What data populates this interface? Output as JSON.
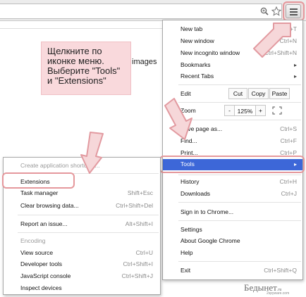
{
  "callout": {
    "line1": "Щелкните по",
    "line2": "иконке меню.",
    "line3": "Выберите \"Tools\"",
    "line4": "и \"Extensions\""
  },
  "page_text": "images",
  "menu": {
    "new_tab": {
      "label": "New tab",
      "shortcut": "Ctrl+T"
    },
    "new_window": {
      "label": "New window",
      "shortcut": "Ctrl+N"
    },
    "new_incognito": {
      "label": "New incognito window",
      "shortcut": "Ctrl+Shift+N"
    },
    "bookmarks": {
      "label": "Bookmarks"
    },
    "recent_tabs": {
      "label": "Recent Tabs"
    },
    "edit": {
      "label": "Edit",
      "cut": "Cut",
      "copy": "Copy",
      "paste": "Paste"
    },
    "zoom": {
      "label": "Zoom",
      "minus": "-",
      "value": "125%",
      "plus": "+"
    },
    "save_page": {
      "label": "Save page as...",
      "shortcut": "Ctrl+S"
    },
    "find": {
      "label": "Find...",
      "shortcut": "Ctrl+F"
    },
    "print": {
      "label": "Print...",
      "shortcut": "Ctrl+P"
    },
    "tools": {
      "label": "Tools"
    },
    "history": {
      "label": "History",
      "shortcut": "Ctrl+H"
    },
    "downloads": {
      "label": "Downloads",
      "shortcut": "Ctrl+J"
    },
    "sign_in": {
      "label": "Sign in to Chrome..."
    },
    "settings": {
      "label": "Settings"
    },
    "about": {
      "label": "About Google Chrome"
    },
    "help": {
      "label": "Help"
    },
    "exit": {
      "label": "Exit",
      "shortcut": "Ctrl+Shift+Q"
    }
  },
  "submenu": {
    "create_shortcuts": {
      "label": "Create application shortcuts..."
    },
    "extensions": {
      "label": "Extensions"
    },
    "task_manager": {
      "label": "Task manager",
      "shortcut": "Shift+Esc"
    },
    "clear_browsing": {
      "label": "Clear browsing data...",
      "shortcut": "Ctrl+Shift+Del"
    },
    "report_issue": {
      "label": "Report an issue...",
      "shortcut": "Alt+Shift+I"
    },
    "encoding": {
      "label": "Encoding"
    },
    "view_source": {
      "label": "View source",
      "shortcut": "Ctrl+U"
    },
    "developer_tools": {
      "label": "Developer tools",
      "shortcut": "Ctrl+Shift+I"
    },
    "js_console": {
      "label": "JavaScript console",
      "shortcut": "Ctrl+Shift+J"
    },
    "inspect_devices": {
      "label": "Inspect devices"
    }
  },
  "watermark": {
    "main": "Бедынет",
    "suffix": ".ru",
    "sub": "2spyware.com"
  },
  "icons": {
    "menu": "hamburger-menu-icon",
    "zoom": "magnifier-icon",
    "star": "bookmark-star-icon",
    "arrow": "pointer-arrow-icon"
  },
  "colors": {
    "highlight": "#3d67d8",
    "callout": "#f9d9dc",
    "arrow_outline": "#e5989c"
  }
}
